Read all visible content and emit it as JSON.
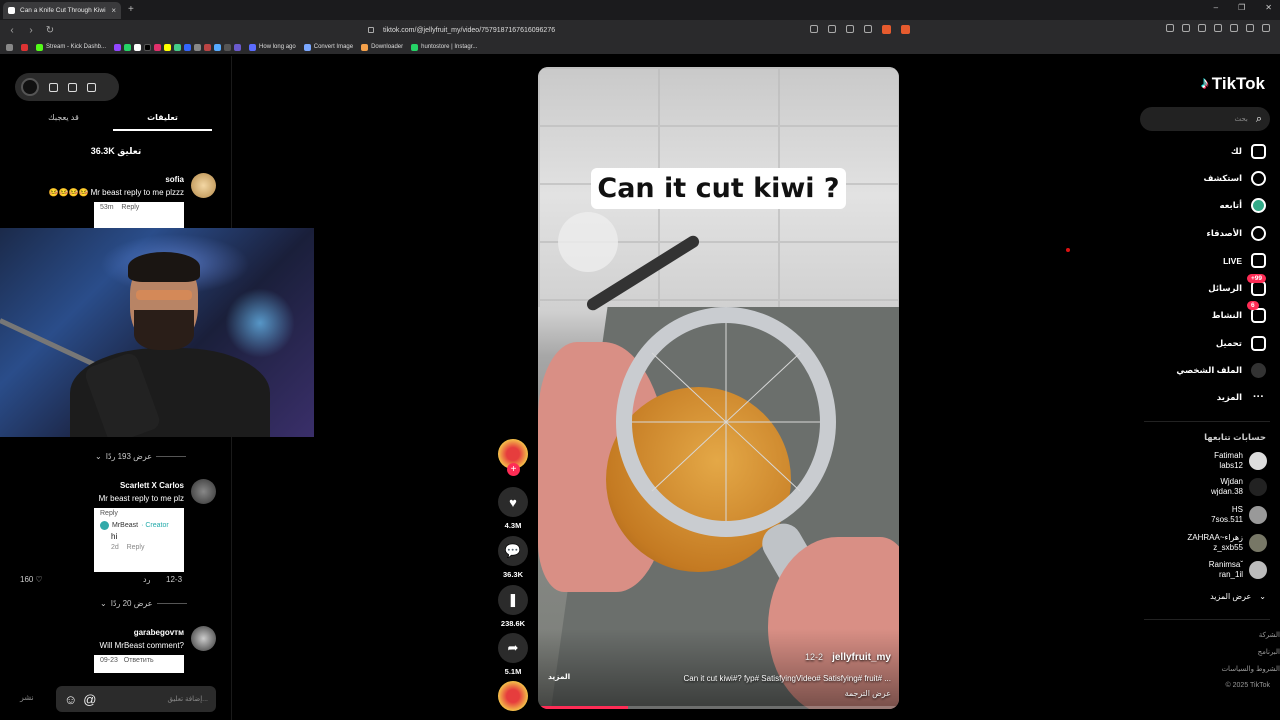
{
  "browser": {
    "tab_title": "Can a Knife Cut Through Kiwi",
    "new_tab": "+",
    "url": "tiktok.com/@jellyfruit_my/video/7579187167616096276",
    "bookmarks": [
      "Stream - Kick Dashb...",
      "How long ago",
      "Convert Image",
      "Downloader",
      "huntostore | Instagr..."
    ],
    "notif_badge": "1"
  },
  "left": {
    "tabs": [
      "قد يعجبك",
      "تعليقات"
    ],
    "comment_count": "36.3K تعليق",
    "comments": [
      {
        "name": "sofia",
        "text": "🤒🤒🤒🤒 Mr beast reply to me plzzz",
        "meta": "53m",
        "reply": "Reply"
      },
      {
        "name": "Scarlett X Carlos",
        "text": "Mr beast reply to me plz",
        "reply": "Reply",
        "creator_name": "MrBeast",
        "creator_tag": "· Creator",
        "creator_text": "hi",
        "creator_meta": "2d",
        "date": "12-3",
        "reply_ar": "رد",
        "likes": "160"
      },
      {
        "name": "garabegovтм",
        "text": "Will MrBeast comment?",
        "meta": "09-23",
        "reply": "Ответить"
      }
    ],
    "view_more_1": "عرض 193 ردًا",
    "view_more_2": "عرض 20 ردًا",
    "compose_placeholder": "إضافة تعليق...",
    "post": "نشر",
    "at": "@"
  },
  "video": {
    "caption": "Can it cut kiwi ?",
    "author": "jellyfruit_my",
    "date": "12-2",
    "description": "Can it cut kiwi#? fyp# SatisfyingVideo# Satisfying# fruit# ...",
    "translate": "عرض الترجمة",
    "more": "المزيد",
    "progress_fraction": 0.25,
    "likes": "4.3M",
    "comments": "36.3K",
    "saves": "238.6K",
    "shares": "5.1M"
  },
  "right": {
    "logo": "TikTok",
    "search_placeholder": "بحث",
    "nav": [
      {
        "label": "لك"
      },
      {
        "label": "استكشف"
      },
      {
        "label": "أتابعه"
      },
      {
        "label": "الأصدقاء"
      },
      {
        "label": "LIVE"
      },
      {
        "label": "الرسائل",
        "badge": "+99"
      },
      {
        "label": "النشاط",
        "badge": "6"
      },
      {
        "label": "تحميل"
      },
      {
        "label": "الملف الشخصي"
      },
      {
        "label": "المزيد"
      }
    ],
    "following_title": "حسابات تتابعها",
    "following": [
      {
        "name": "Fatimah",
        "handle": "labs12"
      },
      {
        "name": "Wjdan",
        "handle": "wjdan.38"
      },
      {
        "name": "HS",
        "handle": "7sos.511"
      },
      {
        "name": "ZAHRAA~زهراء",
        "handle": "z_sxb55"
      },
      {
        "name": "Ranimsaˇ",
        "handle": "ran_1il"
      }
    ],
    "show_more": "عرض المزيد",
    "footer": [
      "الشركة",
      "البرنامج",
      "الشروط والسياسات",
      "© 2025 TikTok"
    ]
  }
}
